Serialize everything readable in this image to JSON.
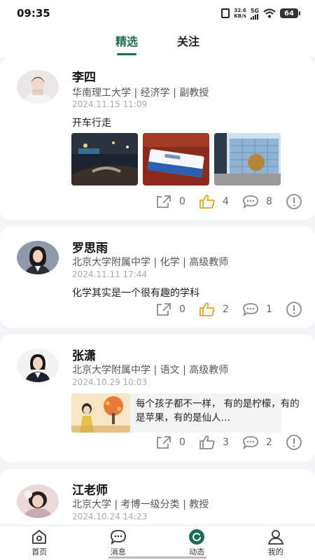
{
  "status_bar": {
    "time": "09:35",
    "net_speed_value": "32.6",
    "net_speed_unit": "KB/s",
    "signal": "5G",
    "battery": "64"
  },
  "top_tabs": [
    {
      "label": "精选",
      "active": true
    },
    {
      "label": "关注",
      "active": false
    }
  ],
  "posts": [
    {
      "name": "李四",
      "org": "华南理工大学 | 经济学 | 副教授",
      "date": "2024.11.15 11:09",
      "text": "开车行走",
      "shares": "0",
      "likes": "4",
      "comments": "8",
      "liked": true,
      "photos": [
        "night-driving-photo",
        "certificate-photo",
        "building-photo"
      ]
    },
    {
      "name": "罗思雨",
      "org": "北京大学附属中学 | 化学 | 高级教师",
      "date": "2024.11.11 17:44",
      "text": "化学其实是一个很有趣的学科",
      "shares": "0",
      "likes": "2",
      "comments": "1",
      "liked": true
    },
    {
      "name": "张潇",
      "org": "北京大学附属中学 | 语文 | 高级教师",
      "date": "2024.10.29 10:03",
      "text": "每个孩子都不一样， 有的是柠檬，有的是苹果，有的是仙人…",
      "shares": "0",
      "likes": "3",
      "comments": "2",
      "liked": false
    },
    {
      "name": "江老师",
      "org": "北京大学 | 考博一级分类 | 教授",
      "date": "2024.10.24 14:23"
    }
  ],
  "bottom_nav": [
    {
      "label": "首页",
      "icon": "home-icon"
    },
    {
      "label": "消息",
      "icon": "message-icon"
    },
    {
      "label": "动态",
      "icon": "feed-icon",
      "active": true
    },
    {
      "label": "我的",
      "icon": "profile-icon"
    }
  ],
  "colors": {
    "accent": "#1f6b55",
    "like_active": "#e8a21a",
    "icon_gray": "#8a8a8a"
  }
}
